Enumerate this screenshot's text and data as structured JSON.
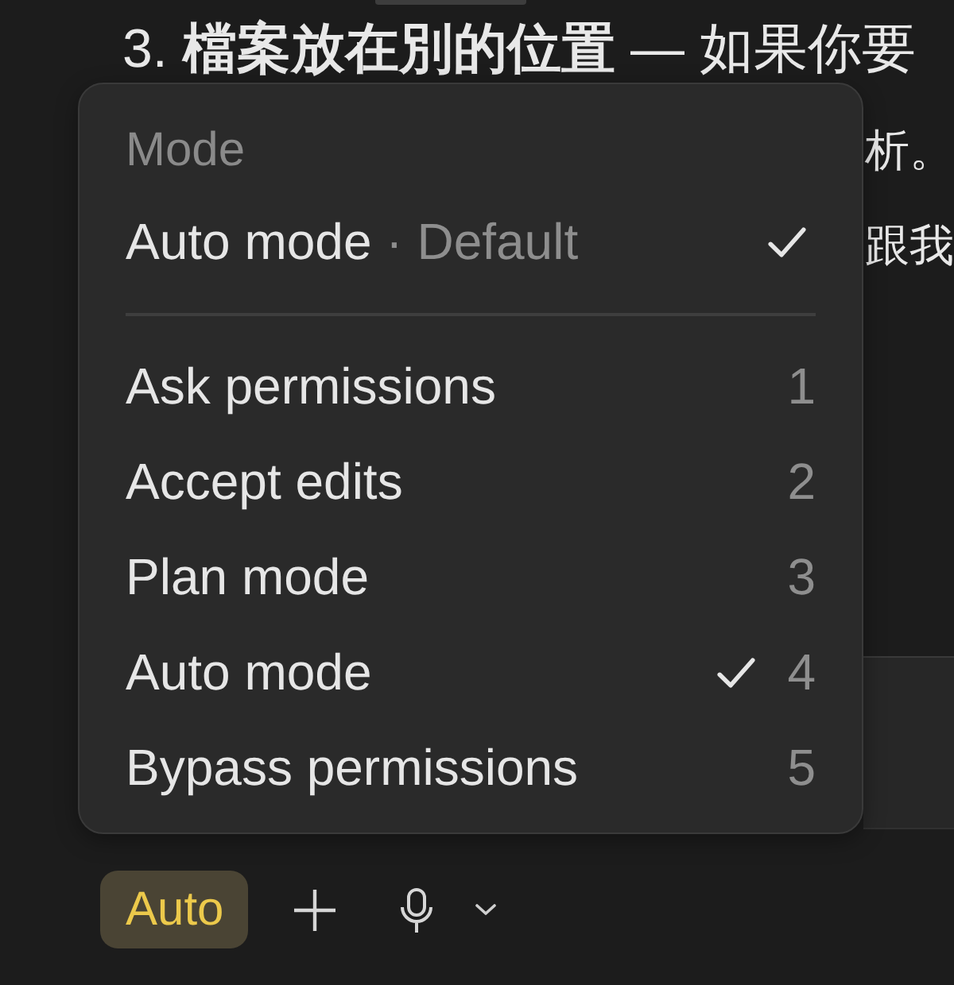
{
  "page_text": {
    "list_number": "3.",
    "line_1": "**檔案放在別的位置** — 如果你要",
    "line_2": "析。",
    "line_3": "跟我"
  },
  "mode_menu": {
    "header": "Mode",
    "default_option": {
      "label": "Auto mode",
      "note": "· Default",
      "checked": true
    },
    "items": [
      {
        "label": "Ask permissions",
        "shortcut": "1",
        "checked": false
      },
      {
        "label": "Accept edits",
        "shortcut": "2",
        "checked": false
      },
      {
        "label": "Plan mode",
        "shortcut": "3",
        "checked": false
      },
      {
        "label": "Auto mode",
        "shortcut": "4",
        "checked": true
      },
      {
        "label": "Bypass permissions",
        "shortcut": "5",
        "checked": false
      }
    ]
  },
  "toolbar": {
    "mode_button": "Auto"
  }
}
